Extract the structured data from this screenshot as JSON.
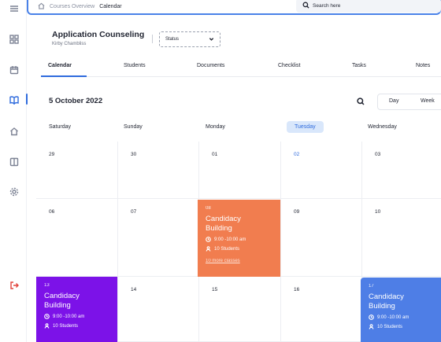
{
  "breadcrumb": {
    "parent": "Courses Overview",
    "current": "Calendar"
  },
  "search": {
    "placeholder": "Search here"
  },
  "header": {
    "title": "Application Counseling",
    "subtitle": "Kirby Chambliss",
    "status_label": "Status"
  },
  "tabs": [
    {
      "label": "Calendar",
      "active": true
    },
    {
      "label": "Students"
    },
    {
      "label": "Documents"
    },
    {
      "label": "Checklist"
    },
    {
      "label": "Tasks"
    },
    {
      "label": "Notes"
    }
  ],
  "calendar": {
    "date_title": "5 October 2022",
    "views": {
      "day": "Day",
      "week": "Week"
    },
    "days": [
      "Saturday",
      "Sunday",
      "Monday",
      "Tuesday",
      "Wednesday"
    ],
    "today_index": 3,
    "week1": [
      "29",
      "30",
      "01",
      "02",
      "03"
    ],
    "week2": [
      "06",
      "07",
      "08",
      "09",
      "10"
    ],
    "week3": [
      "13",
      "14",
      "15",
      "16",
      "17"
    ]
  },
  "events": {
    "e1": {
      "day": "08",
      "title": "Candidacy Building",
      "time": "9:00 -10:00 am",
      "students": "10 Students",
      "more": "10 more classes",
      "color": "#f17d4f"
    },
    "e2": {
      "day": "13",
      "title": "Candidacy Building",
      "time": "9:00 -10:00 am",
      "students": "10 Students",
      "color": "#7c12e8"
    },
    "e3": {
      "day": "17",
      "title": "Candidacy Building",
      "time": "9:00 -10:00 am",
      "students": "10 Students",
      "color": "#4e7ee6"
    }
  },
  "icons": {
    "rail": [
      "menu-icon",
      "grid-icon",
      "calendar-icon",
      "book-open-icon",
      "home-icon",
      "book-icon",
      "settings-icon",
      "logout-icon"
    ]
  },
  "colors": {
    "accent": "#2f6bdd",
    "logout": "#e2433c"
  }
}
